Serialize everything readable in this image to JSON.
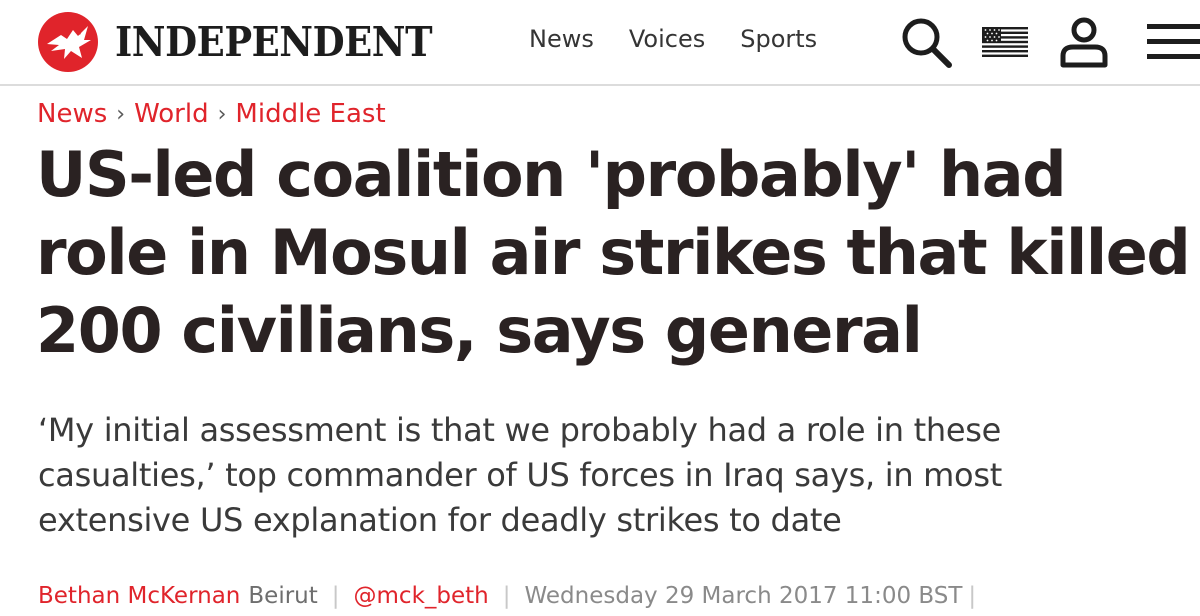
{
  "header": {
    "logo_text": "INDEPENDENT",
    "nav": [
      "News",
      "Voices",
      "Sports"
    ],
    "icons": {
      "logo_mark": "eagle-icon",
      "search": "search-icon",
      "edition": "us-flag-icon",
      "account": "user-icon",
      "menu": "hamburger-menu-icon"
    }
  },
  "breadcrumb": [
    "News",
    "World",
    "Middle East"
  ],
  "breadcrumb_separator": "›",
  "article": {
    "headline": "US-led coalition 'probably' had role in Mosul air strikes that killed 200 civilians, says general",
    "standfirst": "‘My initial assessment is that we probably had a role in these casualties,’ top commander of US forces in Iraq says, in most extensive US explanation for deadly strikes to date",
    "author": "Bethan McKernan",
    "location": "Beirut",
    "twitter": "@mck_beth",
    "date": "Wednesday 29 March 2017 11:00 BST",
    "byline_separator": "|"
  },
  "colors": {
    "accent": "#e0242b",
    "headline": "#2a2222",
    "nav_text": "#353535",
    "muted": "#8a8a8a"
  }
}
